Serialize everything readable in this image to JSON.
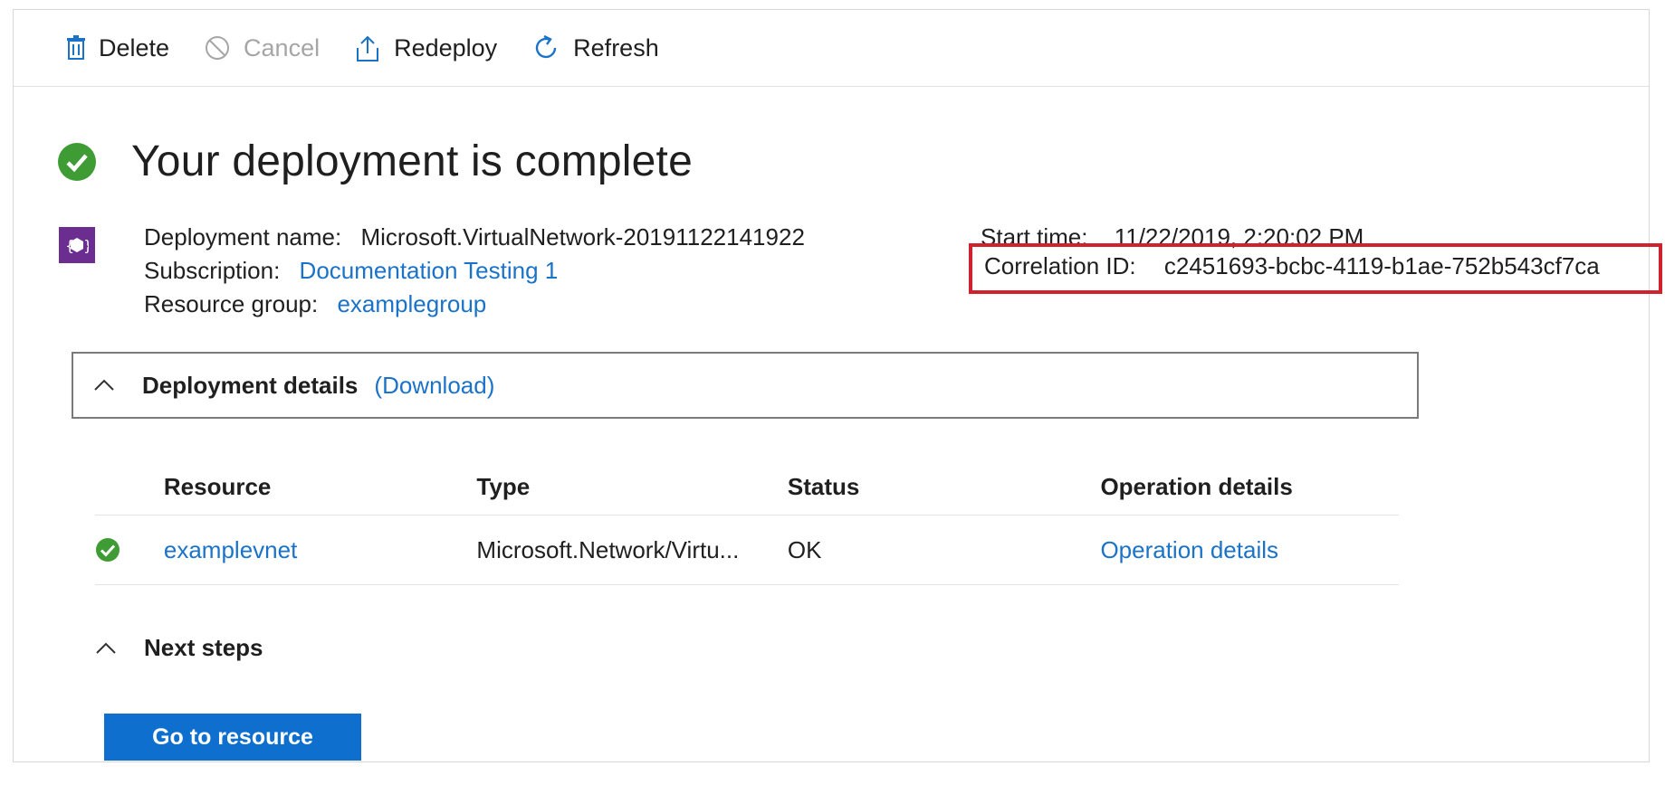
{
  "toolbar": {
    "delete_label": "Delete",
    "cancel_label": "Cancel",
    "redeploy_label": "Redeploy",
    "refresh_label": "Refresh"
  },
  "header": {
    "title": "Your deployment is complete"
  },
  "meta": {
    "deployment_name_label": "Deployment name:",
    "deployment_name_value": "Microsoft.VirtualNetwork-20191122141922",
    "subscription_label": "Subscription:",
    "subscription_value": "Documentation Testing 1",
    "resource_group_label": "Resource group:",
    "resource_group_value": "examplegroup",
    "start_time_label": "Start time:",
    "start_time_value": "11/22/2019, 2:20:02 PM",
    "correlation_label": "Correlation ID:",
    "correlation_value": "c2451693-bcbc-4119-b1ae-752b543cf7ca"
  },
  "details": {
    "title": "Deployment details",
    "download_label": "(Download)"
  },
  "table": {
    "headers": [
      "Resource",
      "Type",
      "Status",
      "Operation details"
    ],
    "rows": [
      {
        "resource": "examplevnet",
        "type": "Microsoft.Network/Virtu...",
        "status": "OK",
        "operation": "Operation details"
      }
    ]
  },
  "next_steps": {
    "title": "Next steps",
    "go_to_resource_label": "Go to resource"
  },
  "colors": {
    "success_green": "#3f9c35",
    "link_blue": "#1a73c8",
    "primary_button": "#0f6fce",
    "highlight_red": "#d0212f",
    "resource_icon_purple": "#6b2d8f"
  },
  "icons": {
    "delete": "trash-icon",
    "cancel": "cancel-icon",
    "redeploy": "upload-icon",
    "refresh": "refresh-icon",
    "status": "check-circle-icon",
    "resource": "resource-group-icon",
    "collapse": "chevron-up-icon"
  }
}
